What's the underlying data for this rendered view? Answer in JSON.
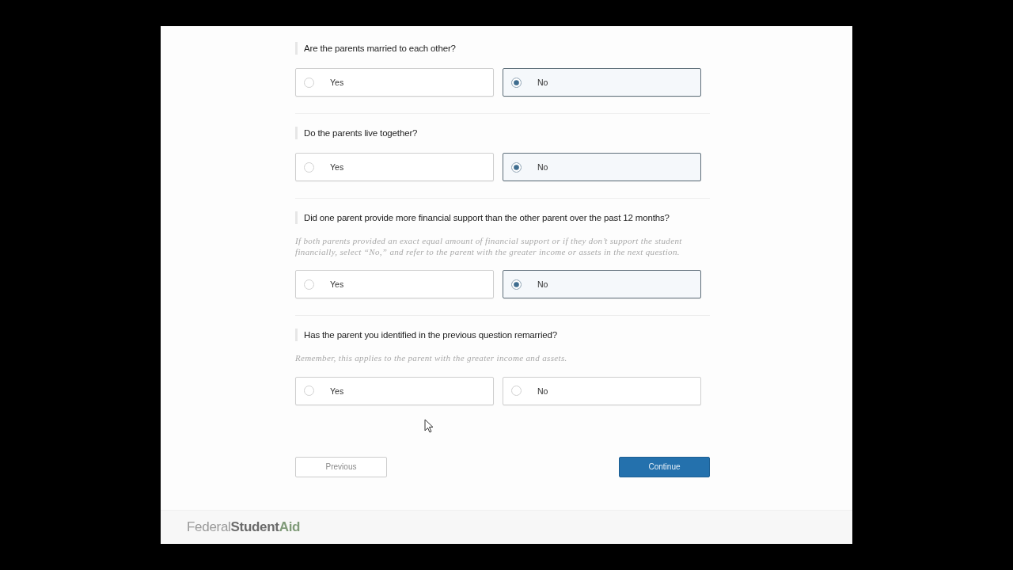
{
  "questions": [
    {
      "text": "Are the parents married to each other?",
      "options": [
        {
          "label": "Yes",
          "selected": false
        },
        {
          "label": "No",
          "selected": true
        }
      ]
    },
    {
      "text": "Do the parents live together?",
      "options": [
        {
          "label": "Yes",
          "selected": false
        },
        {
          "label": "No",
          "selected": true
        }
      ]
    },
    {
      "text": "Did one parent provide more financial support than the other parent over the past 12 months?",
      "hint": "If both parents provided an exact equal amount of financial support or if they don’t support the student financially, select “No,” and refer to the parent with the greater income or assets in the next question.",
      "options": [
        {
          "label": "Yes",
          "selected": false
        },
        {
          "label": "No",
          "selected": true
        }
      ]
    },
    {
      "text": "Has the parent you identified in the previous question remarried?",
      "hint": "Remember, this applies to the parent with the greater income and assets.",
      "options": [
        {
          "label": "Yes",
          "selected": false
        },
        {
          "label": "No",
          "selected": false
        }
      ]
    }
  ],
  "buttons": [
    {
      "label": "Previous",
      "kind": "secondary"
    },
    {
      "label": "Continue",
      "kind": "primary"
    }
  ],
  "footer": {
    "logo": [
      {
        "text": "Federal",
        "kind": "light"
      },
      {
        "text": "Student",
        "kind": "bold"
      },
      {
        "text": "Aid",
        "kind": "accent"
      }
    ]
  }
}
